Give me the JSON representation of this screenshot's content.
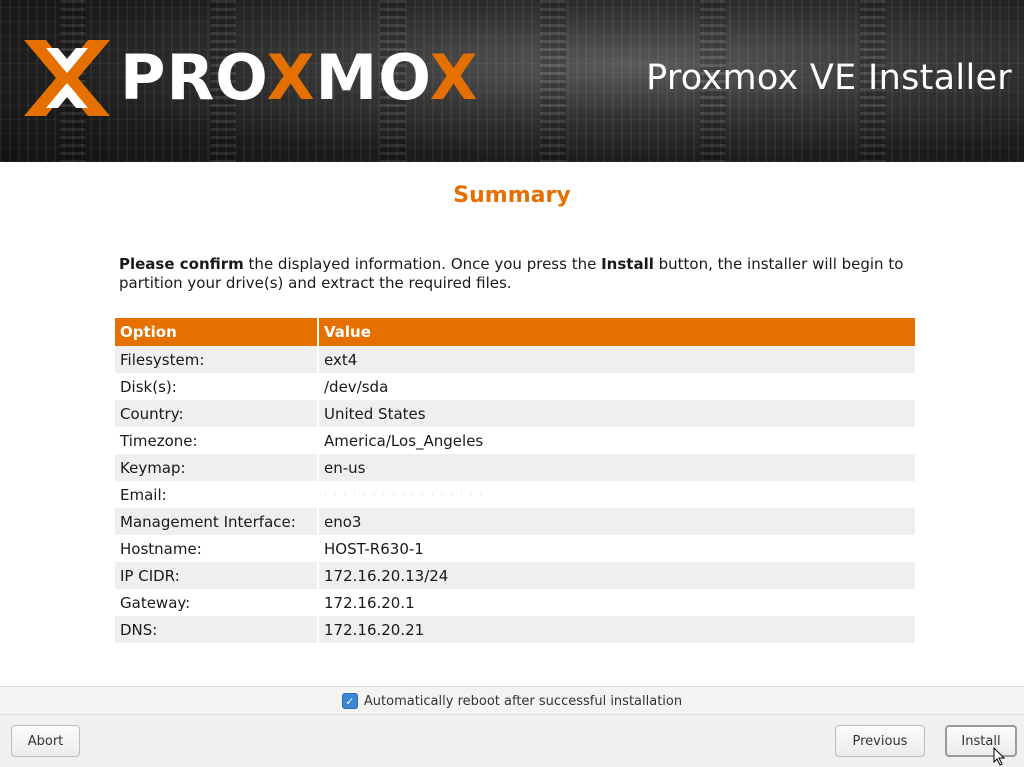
{
  "header": {
    "logo_text_pro": "PRO",
    "logo_text_x": "X",
    "logo_text_mo": "MO",
    "logo_text_x2": "X",
    "installer_title": "Proxmox VE Installer"
  },
  "main": {
    "title": "Summary",
    "intro_bold1": "Please confirm",
    "intro_text1": " the displayed information. Once you press the ",
    "intro_bold2": "Install",
    "intro_text2": " button, the installer will begin to partition your drive(s) and extract the required files.",
    "table": {
      "headers": [
        "Option",
        "Value"
      ],
      "rows": [
        {
          "option": "Filesystem:",
          "value": "ext4"
        },
        {
          "option": "Disk(s):",
          "value": "/dev/sda"
        },
        {
          "option": "Country:",
          "value": "United States"
        },
        {
          "option": "Timezone:",
          "value": "America/Los_Angeles"
        },
        {
          "option": "Keymap:",
          "value": "en-us"
        },
        {
          "option": "Email:",
          "value": "· · · · · · · · · · · · · · · · ·"
        },
        {
          "option": "Management Interface:",
          "value": "eno3"
        },
        {
          "option": "Hostname:",
          "value": "HOST-R630-1"
        },
        {
          "option": "IP CIDR:",
          "value": "172.16.20.13/24"
        },
        {
          "option": "Gateway:",
          "value": "172.16.20.1"
        },
        {
          "option": "DNS:",
          "value": "172.16.20.21"
        }
      ]
    }
  },
  "reboot": {
    "checked": true,
    "label": "Automatically reboot after successful installation"
  },
  "buttons": {
    "abort": "Abort",
    "previous": "Previous",
    "install": "Install"
  },
  "colors": {
    "accent": "#e57000",
    "checkbox": "#3d86d4"
  }
}
